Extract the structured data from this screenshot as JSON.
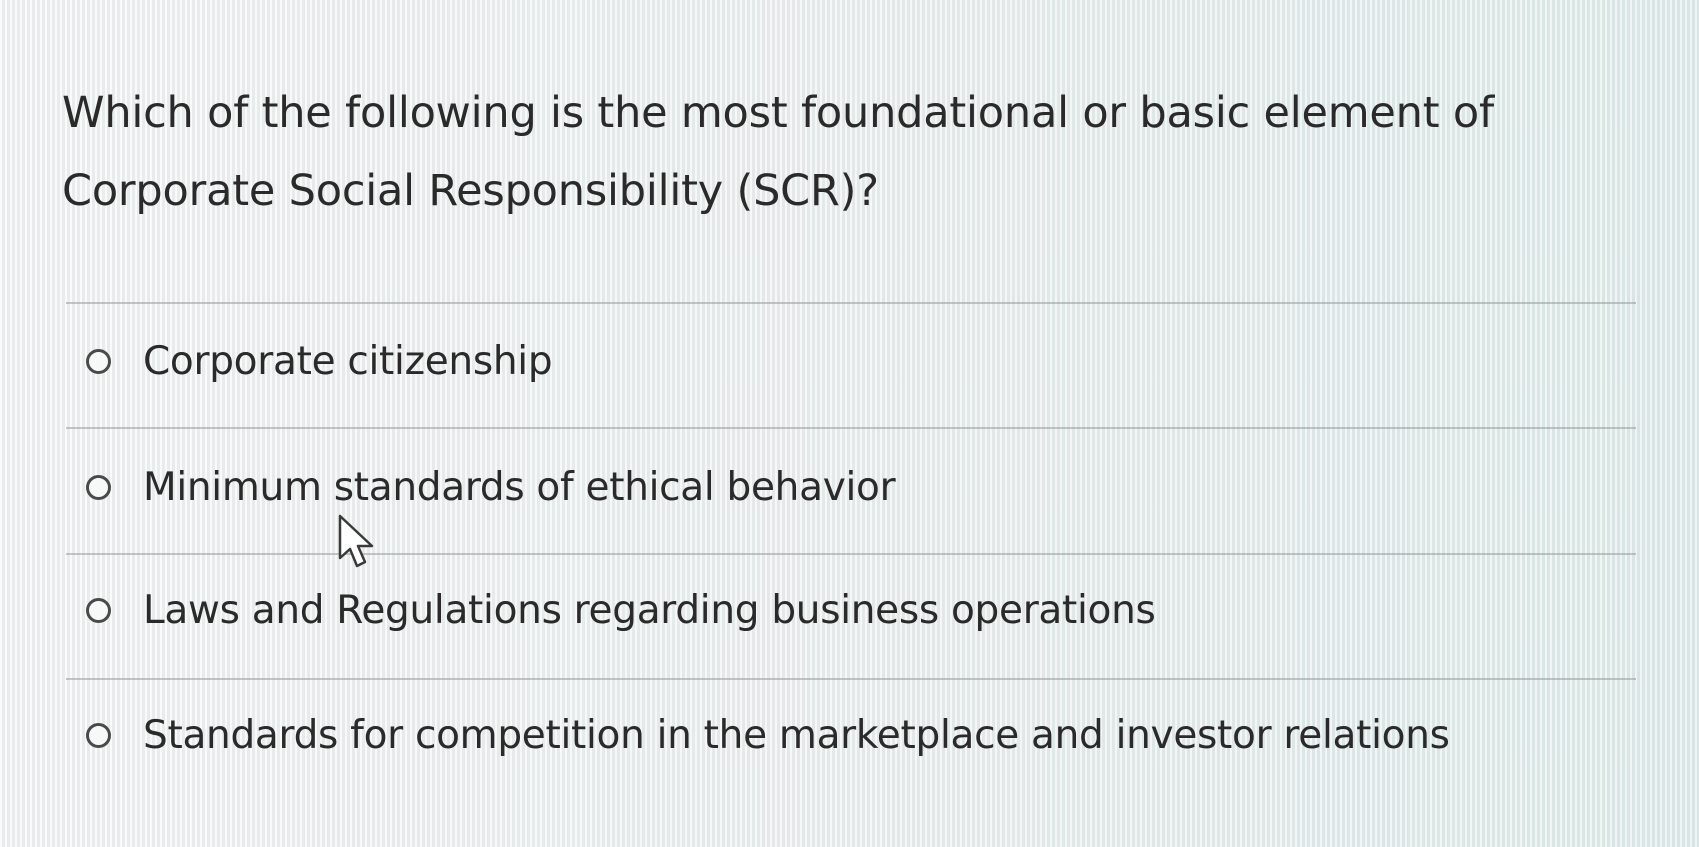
{
  "question": {
    "text": "Which of the following is the most foundational or basic element of Corporate Social Responsibility (SCR)?"
  },
  "options": [
    {
      "label": "Corporate citizenship",
      "selected": false
    },
    {
      "label": "Minimum standards of ethical behavior",
      "selected": false
    },
    {
      "label": "Laws and Regulations regarding business operations",
      "selected": false
    },
    {
      "label": "Standards for competition in the marketplace and investor relations",
      "selected": false
    }
  ],
  "cursor": {
    "icon": "mouse-pointer-icon"
  }
}
